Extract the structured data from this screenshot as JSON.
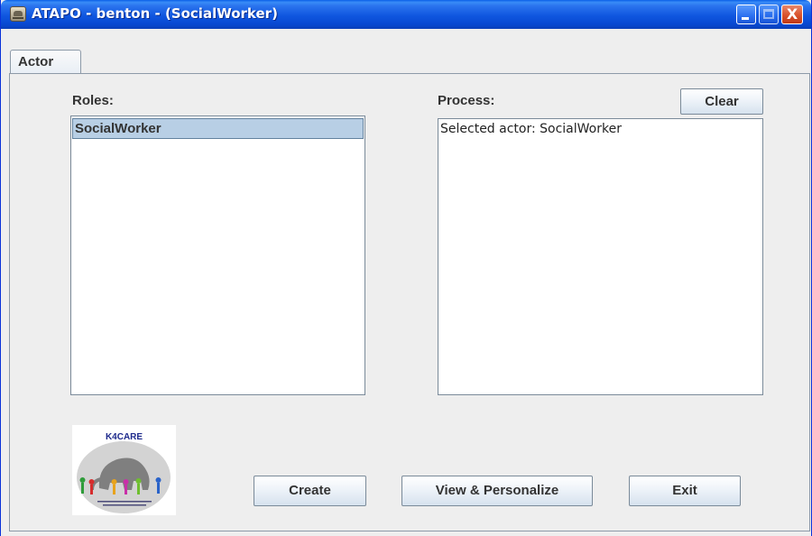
{
  "window": {
    "title": "ATAPO - benton - (SocialWorker)",
    "controls": {
      "minimize": "minimize",
      "maximize": "maximize",
      "close": "X"
    }
  },
  "tabs": [
    {
      "label": "Actor",
      "selected": true
    }
  ],
  "roles": {
    "label": "Roles:",
    "items": [
      {
        "label": "SocialWorker",
        "selected": true
      }
    ]
  },
  "process": {
    "label": "Process:",
    "clear_label": "Clear",
    "text": "Selected actor: SocialWorker"
  },
  "logo": {
    "text": "K4CARE"
  },
  "actions": {
    "create_label": "Create",
    "view_label": "View & Personalize",
    "exit_label": "Exit"
  },
  "colors": {
    "titlebar": "#0a56e0",
    "selection": "#b8cfe5",
    "background": "#eeeeee",
    "close_button": "#d9522b"
  }
}
